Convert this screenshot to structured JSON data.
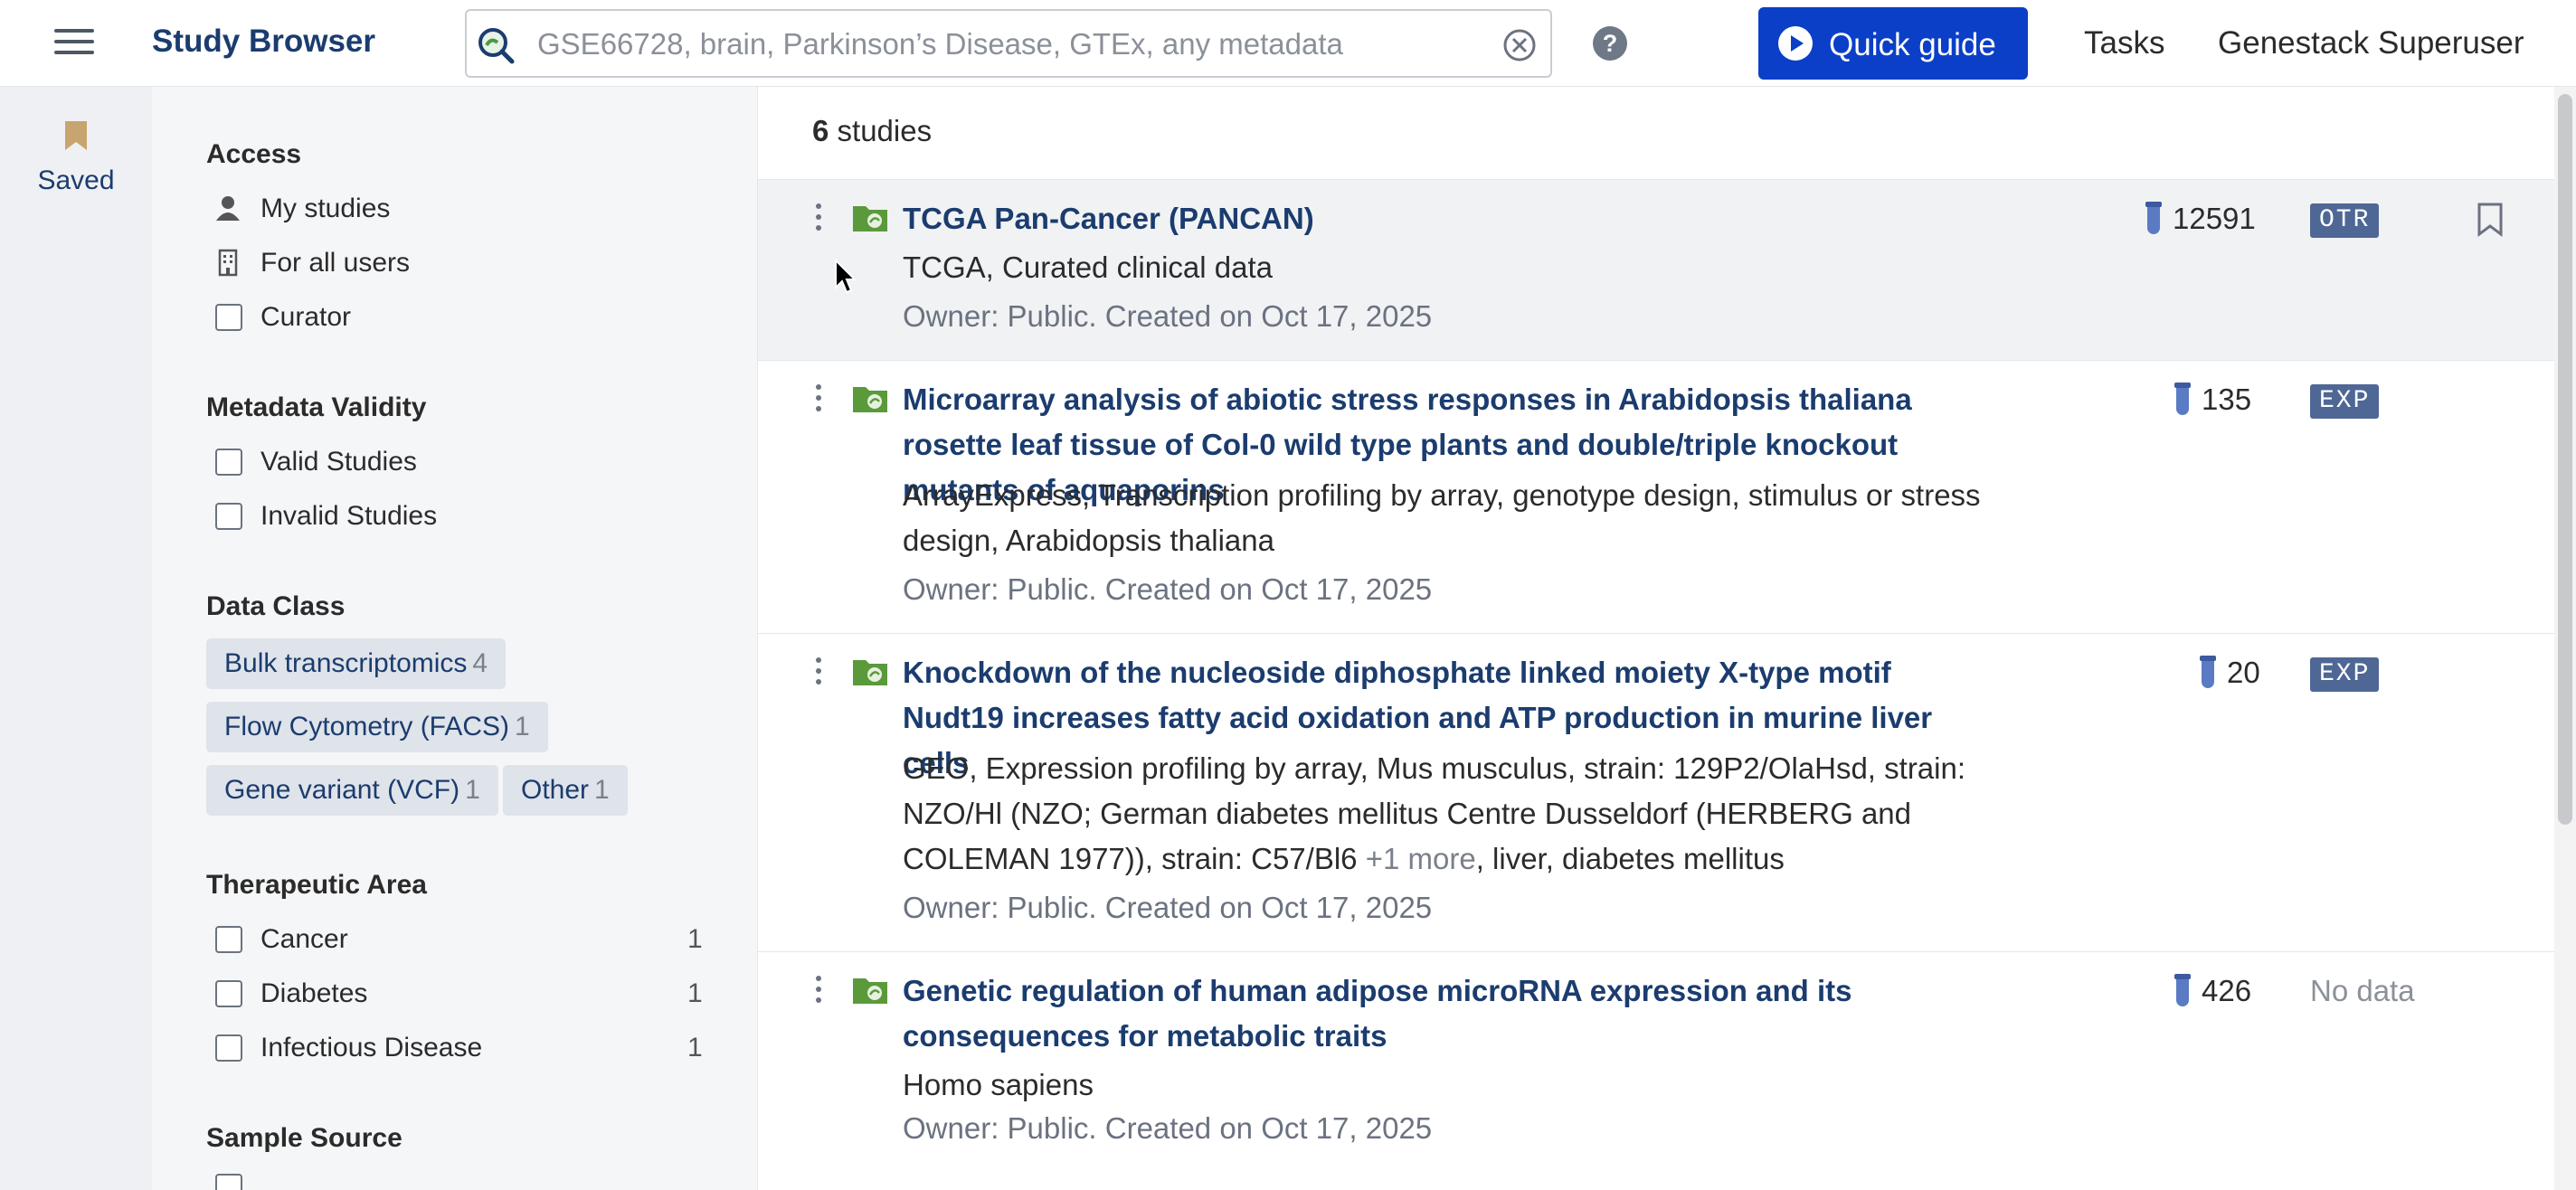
{
  "header": {
    "title": "Study Browser",
    "search_placeholder": "GSE66728, brain, Parkinson’s Disease, GTEx, any metadata",
    "search_value": "",
    "help_label": "?",
    "quick_guide_label": "Quick guide",
    "tasks_label": "Tasks",
    "user_label": "Genestack Superuser",
    "accent_color": "#0b3fc7"
  },
  "rail": {
    "saved_label": "Saved"
  },
  "filters": {
    "access": {
      "title": "Access",
      "items": [
        {
          "label": "My studies",
          "icon": "person-icon"
        },
        {
          "label": "For all users",
          "icon": "building-icon"
        },
        {
          "label": "Curator",
          "icon": "checkbox"
        }
      ]
    },
    "validity": {
      "title": "Metadata Validity",
      "items": [
        {
          "label": "Valid Studies",
          "checked": false
        },
        {
          "label": "Invalid Studies",
          "checked": false
        }
      ]
    },
    "data_class": {
      "title": "Data Class",
      "chips": [
        {
          "label": "Bulk transcriptomics",
          "count": "4"
        },
        {
          "label": "Flow Cytometry (FACS)",
          "count": "1"
        },
        {
          "label": "Gene variant (VCF)",
          "count": "1"
        },
        {
          "label": "Other",
          "count": "1"
        }
      ]
    },
    "therapeutic": {
      "title": "Therapeutic Area",
      "items": [
        {
          "label": "Cancer",
          "count": "1",
          "checked": false
        },
        {
          "label": "Diabetes",
          "count": "1",
          "checked": false
        },
        {
          "label": "Infectious Disease",
          "count": "1",
          "checked": false
        }
      ]
    },
    "sample_source": {
      "title": "Sample Source"
    }
  },
  "results": {
    "count": "6",
    "count_suffix": "studies",
    "studies": [
      {
        "title": "TCGA Pan-Cancer (PANCAN)",
        "description": "TCGA, Curated clinical data",
        "owner": "Owner: Public. Created on Oct 17, 2025",
        "samples": "12591",
        "badge": "OTR"
      },
      {
        "title": "Microarray analysis of abiotic stress responses in Arabidopsis thaliana rosette leaf tissue of Col-0 wild type plants and double/triple knockout mutants of aquaporins",
        "description": "ArrayExpress, Transcription profiling by array, genotype design, stimulus or stress design, Arabidopsis thaliana",
        "owner": "Owner: Public. Created on Oct 17, 2025",
        "samples": "135",
        "badge": "EXP"
      },
      {
        "title": "Knockdown of the nucleoside diphosphate linked moiety X-type motif Nudt19 increases fatty acid oxidation and ATP production in murine liver cells",
        "description_before": "GEO, Expression profiling by array, Mus musculus, strain: 129P2/OlaHsd, strain: NZO/Hl (NZO; German diabetes mellitus Centre Dusseldorf (HERBERG and COLEMAN 1977)), strain: C57/Bl6 ",
        "description_more": "+1 more",
        "description_after": ", liver, diabetes mellitus",
        "owner": "Owner: Public. Created on Oct 17, 2025",
        "samples": "20",
        "badge": "EXP"
      },
      {
        "title": "Genetic regulation of human adipose microRNA expression and its consequences for metabolic traits",
        "description": "Homo sapiens",
        "owner": "Owner: Public. Created on Oct 17, 2025",
        "samples": "426",
        "badge_text": "No data"
      }
    ]
  }
}
